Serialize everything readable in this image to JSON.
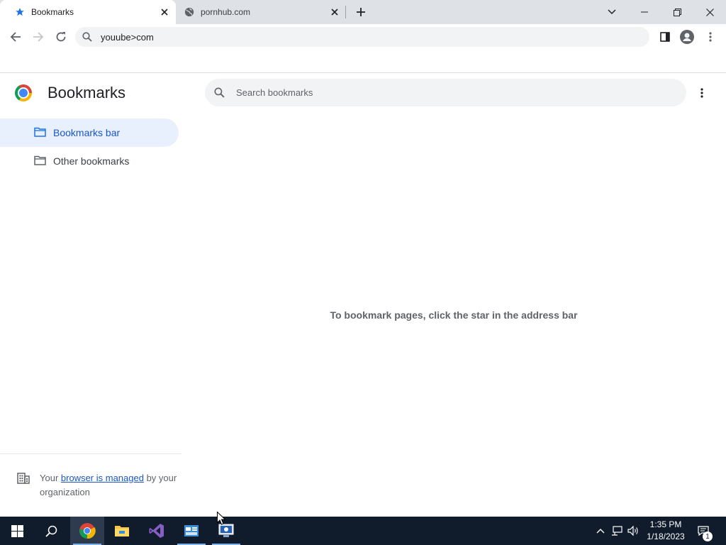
{
  "tabs": [
    {
      "title": "Bookmarks",
      "icon": "star-icon",
      "active": true
    },
    {
      "title": "pornhub.com",
      "icon": "globe-icon",
      "active": false
    }
  ],
  "toolbar": {
    "address": "youube>com"
  },
  "page": {
    "title": "Bookmarks",
    "search_placeholder": "Search bookmarks",
    "empty_message": "To bookmark pages, click the star in the address bar"
  },
  "sidebar": {
    "items": [
      {
        "label": "Bookmarks bar",
        "selected": true
      },
      {
        "label": "Other bookmarks",
        "selected": false
      }
    ],
    "managed": {
      "prefix": "Your ",
      "link": "browser is managed",
      "suffix": " by your organization"
    }
  },
  "taskbar": {
    "apps": [
      "start-icon",
      "search-icon",
      "chrome-icon",
      "file-explorer-icon",
      "visual-studio-icon",
      "control-panel-icon",
      "remote-desktop-icon"
    ],
    "time": "1:35 PM",
    "date": "1/18/2023",
    "notification_count": "1"
  },
  "colors": {
    "accent": "#1a73e8",
    "selected_bg": "#e8f0fe",
    "taskbar": "#101b2b"
  }
}
